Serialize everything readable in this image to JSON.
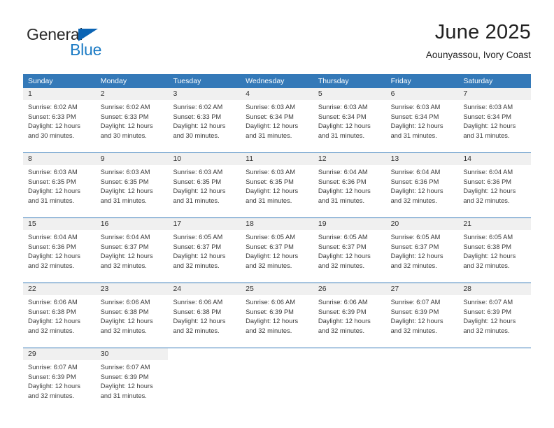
{
  "branding": {
    "logo_text_top": "General",
    "logo_text_bottom": "Blue",
    "logo_icon": "triangle-icon",
    "accent_color": "#0b64b4",
    "logo_blue_color": "#1a7ac4"
  },
  "header": {
    "month_title": "June 2025",
    "location": "Aounyassou, Ivory Coast"
  },
  "calendar": {
    "header_bg": "#3479b8",
    "header_text_color": "#ffffff",
    "day_strip_bg": "#f0f0f0",
    "weekdays": [
      "Sunday",
      "Monday",
      "Tuesday",
      "Wednesday",
      "Thursday",
      "Friday",
      "Saturday"
    ],
    "weeks": [
      [
        {
          "day": "1",
          "sunrise": "Sunrise: 6:02 AM",
          "sunset": "Sunset: 6:33 PM",
          "daylight_1": "Daylight: 12 hours",
          "daylight_2": "and 30 minutes."
        },
        {
          "day": "2",
          "sunrise": "Sunrise: 6:02 AM",
          "sunset": "Sunset: 6:33 PM",
          "daylight_1": "Daylight: 12 hours",
          "daylight_2": "and 30 minutes."
        },
        {
          "day": "3",
          "sunrise": "Sunrise: 6:02 AM",
          "sunset": "Sunset: 6:33 PM",
          "daylight_1": "Daylight: 12 hours",
          "daylight_2": "and 30 minutes."
        },
        {
          "day": "4",
          "sunrise": "Sunrise: 6:03 AM",
          "sunset": "Sunset: 6:34 PM",
          "daylight_1": "Daylight: 12 hours",
          "daylight_2": "and 31 minutes."
        },
        {
          "day": "5",
          "sunrise": "Sunrise: 6:03 AM",
          "sunset": "Sunset: 6:34 PM",
          "daylight_1": "Daylight: 12 hours",
          "daylight_2": "and 31 minutes."
        },
        {
          "day": "6",
          "sunrise": "Sunrise: 6:03 AM",
          "sunset": "Sunset: 6:34 PM",
          "daylight_1": "Daylight: 12 hours",
          "daylight_2": "and 31 minutes."
        },
        {
          "day": "7",
          "sunrise": "Sunrise: 6:03 AM",
          "sunset": "Sunset: 6:34 PM",
          "daylight_1": "Daylight: 12 hours",
          "daylight_2": "and 31 minutes."
        }
      ],
      [
        {
          "day": "8",
          "sunrise": "Sunrise: 6:03 AM",
          "sunset": "Sunset: 6:35 PM",
          "daylight_1": "Daylight: 12 hours",
          "daylight_2": "and 31 minutes."
        },
        {
          "day": "9",
          "sunrise": "Sunrise: 6:03 AM",
          "sunset": "Sunset: 6:35 PM",
          "daylight_1": "Daylight: 12 hours",
          "daylight_2": "and 31 minutes."
        },
        {
          "day": "10",
          "sunrise": "Sunrise: 6:03 AM",
          "sunset": "Sunset: 6:35 PM",
          "daylight_1": "Daylight: 12 hours",
          "daylight_2": "and 31 minutes."
        },
        {
          "day": "11",
          "sunrise": "Sunrise: 6:03 AM",
          "sunset": "Sunset: 6:35 PM",
          "daylight_1": "Daylight: 12 hours",
          "daylight_2": "and 31 minutes."
        },
        {
          "day": "12",
          "sunrise": "Sunrise: 6:04 AM",
          "sunset": "Sunset: 6:36 PM",
          "daylight_1": "Daylight: 12 hours",
          "daylight_2": "and 31 minutes."
        },
        {
          "day": "13",
          "sunrise": "Sunrise: 6:04 AM",
          "sunset": "Sunset: 6:36 PM",
          "daylight_1": "Daylight: 12 hours",
          "daylight_2": "and 32 minutes."
        },
        {
          "day": "14",
          "sunrise": "Sunrise: 6:04 AM",
          "sunset": "Sunset: 6:36 PM",
          "daylight_1": "Daylight: 12 hours",
          "daylight_2": "and 32 minutes."
        }
      ],
      [
        {
          "day": "15",
          "sunrise": "Sunrise: 6:04 AM",
          "sunset": "Sunset: 6:36 PM",
          "daylight_1": "Daylight: 12 hours",
          "daylight_2": "and 32 minutes."
        },
        {
          "day": "16",
          "sunrise": "Sunrise: 6:04 AM",
          "sunset": "Sunset: 6:37 PM",
          "daylight_1": "Daylight: 12 hours",
          "daylight_2": "and 32 minutes."
        },
        {
          "day": "17",
          "sunrise": "Sunrise: 6:05 AM",
          "sunset": "Sunset: 6:37 PM",
          "daylight_1": "Daylight: 12 hours",
          "daylight_2": "and 32 minutes."
        },
        {
          "day": "18",
          "sunrise": "Sunrise: 6:05 AM",
          "sunset": "Sunset: 6:37 PM",
          "daylight_1": "Daylight: 12 hours",
          "daylight_2": "and 32 minutes."
        },
        {
          "day": "19",
          "sunrise": "Sunrise: 6:05 AM",
          "sunset": "Sunset: 6:37 PM",
          "daylight_1": "Daylight: 12 hours",
          "daylight_2": "and 32 minutes."
        },
        {
          "day": "20",
          "sunrise": "Sunrise: 6:05 AM",
          "sunset": "Sunset: 6:37 PM",
          "daylight_1": "Daylight: 12 hours",
          "daylight_2": "and 32 minutes."
        },
        {
          "day": "21",
          "sunrise": "Sunrise: 6:05 AM",
          "sunset": "Sunset: 6:38 PM",
          "daylight_1": "Daylight: 12 hours",
          "daylight_2": "and 32 minutes."
        }
      ],
      [
        {
          "day": "22",
          "sunrise": "Sunrise: 6:06 AM",
          "sunset": "Sunset: 6:38 PM",
          "daylight_1": "Daylight: 12 hours",
          "daylight_2": "and 32 minutes."
        },
        {
          "day": "23",
          "sunrise": "Sunrise: 6:06 AM",
          "sunset": "Sunset: 6:38 PM",
          "daylight_1": "Daylight: 12 hours",
          "daylight_2": "and 32 minutes."
        },
        {
          "day": "24",
          "sunrise": "Sunrise: 6:06 AM",
          "sunset": "Sunset: 6:38 PM",
          "daylight_1": "Daylight: 12 hours",
          "daylight_2": "and 32 minutes."
        },
        {
          "day": "25",
          "sunrise": "Sunrise: 6:06 AM",
          "sunset": "Sunset: 6:39 PM",
          "daylight_1": "Daylight: 12 hours",
          "daylight_2": "and 32 minutes."
        },
        {
          "day": "26",
          "sunrise": "Sunrise: 6:06 AM",
          "sunset": "Sunset: 6:39 PM",
          "daylight_1": "Daylight: 12 hours",
          "daylight_2": "and 32 minutes."
        },
        {
          "day": "27",
          "sunrise": "Sunrise: 6:07 AM",
          "sunset": "Sunset: 6:39 PM",
          "daylight_1": "Daylight: 12 hours",
          "daylight_2": "and 32 minutes."
        },
        {
          "day": "28",
          "sunrise": "Sunrise: 6:07 AM",
          "sunset": "Sunset: 6:39 PM",
          "daylight_1": "Daylight: 12 hours",
          "daylight_2": "and 32 minutes."
        }
      ],
      [
        {
          "day": "29",
          "sunrise": "Sunrise: 6:07 AM",
          "sunset": "Sunset: 6:39 PM",
          "daylight_1": "Daylight: 12 hours",
          "daylight_2": "and 32 minutes."
        },
        {
          "day": "30",
          "sunrise": "Sunrise: 6:07 AM",
          "sunset": "Sunset: 6:39 PM",
          "daylight_1": "Daylight: 12 hours",
          "daylight_2": "and 31 minutes."
        },
        {
          "day": "",
          "sunrise": "",
          "sunset": "",
          "daylight_1": "",
          "daylight_2": ""
        },
        {
          "day": "",
          "sunrise": "",
          "sunset": "",
          "daylight_1": "",
          "daylight_2": ""
        },
        {
          "day": "",
          "sunrise": "",
          "sunset": "",
          "daylight_1": "",
          "daylight_2": ""
        },
        {
          "day": "",
          "sunrise": "",
          "sunset": "",
          "daylight_1": "",
          "daylight_2": ""
        },
        {
          "day": "",
          "sunrise": "",
          "sunset": "",
          "daylight_1": "",
          "daylight_2": ""
        }
      ]
    ]
  }
}
